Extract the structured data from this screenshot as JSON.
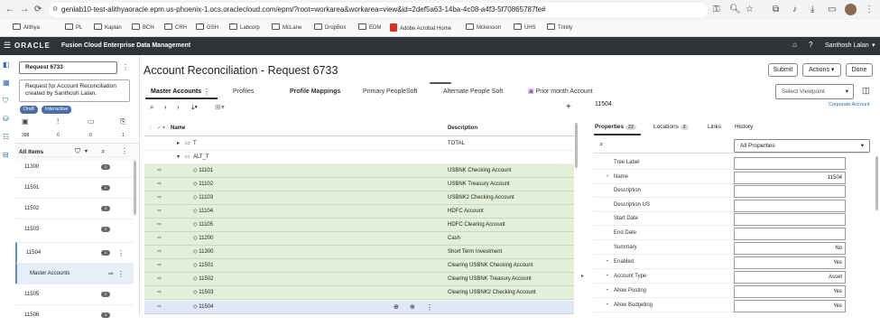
{
  "browser": {
    "url": "genlab10-test-alithyaoracle.epm.us-phoenix-1.ocs.oraclecloud.com/epm/?root=workarea&workarea=view&id=2def5a63-14ba-4c08-a4f3-5f70865787fe#",
    "bookmarks": [
      "Alithya",
      "PL",
      "Kaplan",
      "BCH",
      "CRH",
      "GSH",
      "Labcorp",
      "McLane",
      "DropBox",
      "EDM",
      "Adobe Acrobat Home",
      "Mckesson",
      "UHS",
      "Trinity"
    ]
  },
  "oracle_bar": {
    "logo": "ORACLE",
    "product": "Fusion Cloud Enterprise Data Management",
    "user": "Santhosh Lalan"
  },
  "left": {
    "request_box": "Request 6733",
    "request_desc": "Request for Account Reconciliation created by Santhosh Lalan.",
    "chip_draft": "Draft",
    "chip_interactive": "Interactive",
    "counts": [
      "398",
      "0",
      "0",
      "1"
    ],
    "list_title": "All Items",
    "items": [
      {
        "label": "11300",
        "badge": "1"
      },
      {
        "label": "11501",
        "badge": "1"
      },
      {
        "label": "11502",
        "badge": "1"
      },
      {
        "label": "11503",
        "badge": "1"
      },
      {
        "label": "11504",
        "badge": "1"
      },
      {
        "label": "Master Accounts",
        "badge": ""
      },
      {
        "label": "11505",
        "badge": "1"
      },
      {
        "label": "11506",
        "badge": "1"
      }
    ]
  },
  "main": {
    "title": "Account Reconciliation - Request 6733",
    "tabs": [
      "Master Accounts",
      "Profiles",
      "Profile Mappings",
      "Primary PeopleSoft",
      "Alternate People Soft",
      "Prior month Account"
    ],
    "col_name": "Name",
    "col_desc": "Description",
    "tree": [
      {
        "name": "T",
        "desc": "TOTAL"
      },
      {
        "name": "ALT_T",
        "desc": ""
      }
    ],
    "rows": [
      {
        "name": "11101",
        "desc": "USBNK Checking Account"
      },
      {
        "name": "11102",
        "desc": "USBNK Treasury Account"
      },
      {
        "name": "11103",
        "desc": "USBNK2 Checking Account"
      },
      {
        "name": "11104",
        "desc": "HDFC Account"
      },
      {
        "name": "11105",
        "desc": "HDFC Clearing Account"
      },
      {
        "name": "11200",
        "desc": "Cash"
      },
      {
        "name": "11300",
        "desc": "Short Term Investment"
      },
      {
        "name": "11501",
        "desc": "Clearing USBNK Checking Account"
      },
      {
        "name": "11502",
        "desc": "Clearing USBNK Treasury Account"
      },
      {
        "name": "11503",
        "desc": "Clearing USBNK2 Checking Account"
      },
      {
        "name": "11504",
        "desc": ""
      }
    ]
  },
  "right": {
    "buttons": {
      "submit": "Submit",
      "actions": "Actions",
      "done": "Done"
    },
    "viewpoint": "Select Viewpoint",
    "app_link": "Corporate Account",
    "node": "11504",
    "tabs": [
      {
        "label": "Properties",
        "count": "22"
      },
      {
        "label": "Locations",
        "count": "2"
      },
      {
        "label": "Links",
        "count": ""
      },
      {
        "label": "History",
        "count": ""
      }
    ],
    "filter": "All Properties",
    "props": [
      {
        "label": "Tree Label",
        "value": ""
      },
      {
        "label": "Name",
        "value": "11504"
      },
      {
        "label": "Description",
        "value": ""
      },
      {
        "label": "Description US",
        "value": ""
      },
      {
        "label": "Start Date",
        "value": ""
      },
      {
        "label": "End Date",
        "value": ""
      },
      {
        "label": "Summary",
        "value": "No"
      },
      {
        "label": "Enabled",
        "value": "Yes"
      },
      {
        "label": "Account Type",
        "value": "Asset"
      },
      {
        "label": "Allow Posting",
        "value": "Yes"
      },
      {
        "label": "Allow Budgeting",
        "value": "Yes"
      }
    ]
  }
}
